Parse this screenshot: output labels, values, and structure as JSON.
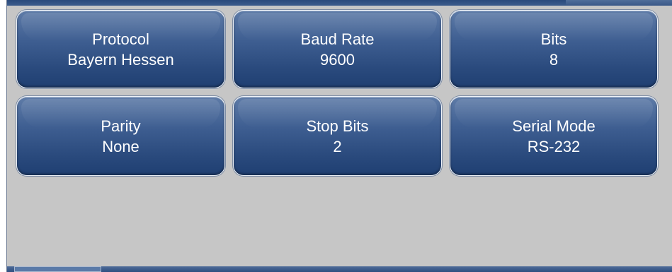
{
  "settings": {
    "tiles": [
      {
        "label": "Protocol",
        "value": "Bayern Hessen"
      },
      {
        "label": "Baud Rate",
        "value": "9600"
      },
      {
        "label": "Bits",
        "value": "8"
      },
      {
        "label": "Parity",
        "value": "None"
      },
      {
        "label": "Stop Bits",
        "value": "2"
      },
      {
        "label": "Serial Mode",
        "value": "RS-232"
      }
    ]
  },
  "colors": {
    "background": "#c6c6c6",
    "tile_top": "#5f7ca8",
    "tile_bottom": "#1f3f72",
    "text": "#ffffff",
    "accent_bar": "#2f4f80"
  }
}
